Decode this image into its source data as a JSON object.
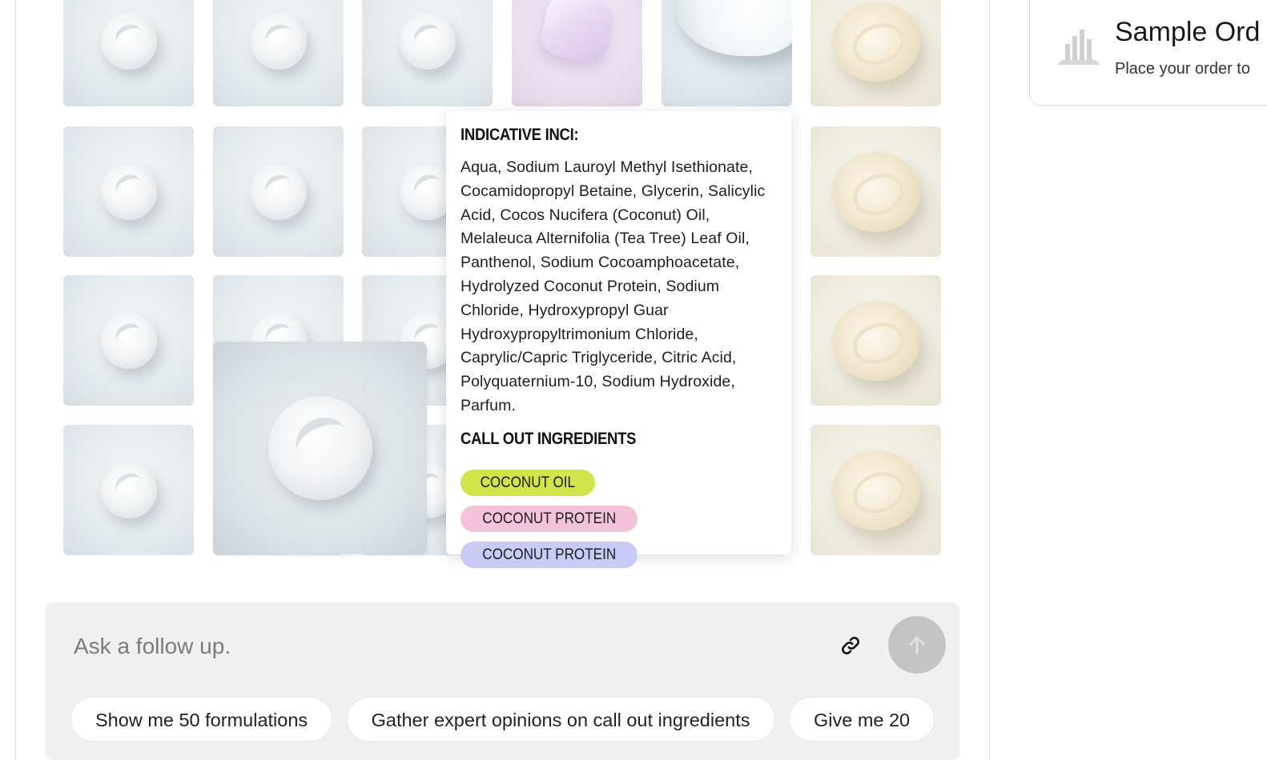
{
  "popover": {
    "inci_heading": "INDICATIVE INCI:",
    "inci_text": "Aqua, Sodium Lauroyl Methyl Isethionate, Cocamidopropyl Betaine, Glycerin, Salicylic Acid, Cocos Nucifera (Coconut) Oil, Melaleuca Alternifolia (Tea Tree) Leaf Oil, Panthenol, Sodium Cocoamphoacetate, Hydrolyzed Coconut Protein, Sodium Chloride, Hydroxypropyl Guar Hydroxypropyltrimonium Chloride, Caprylic/Capric Triglyceride, Citric Acid, Polyquaternium-10, Sodium Hydroxide, Parfum.",
    "callout_heading": "CALL OUT INGREDIENTS",
    "chips": [
      {
        "label": "COCONUT OIL",
        "color": "#cfe54a"
      },
      {
        "label": "COCONUT PROTEIN",
        "color": "#f3c3d9"
      },
      {
        "label": "COCONUT PROTEIN",
        "color": "#c9cbf6"
      }
    ]
  },
  "composer": {
    "placeholder": "Ask a follow up.",
    "link_icon": "link-icon",
    "send_icon": "arrow-up-icon"
  },
  "suggestions": [
    "Show me 50 formulations",
    "Gather expert opinions on call out ingredients",
    "Give me 20"
  ],
  "sample_card": {
    "title": "Sample Ord",
    "subtitle": "Place your order to",
    "icon": "bar-chart-icon"
  },
  "colors": {
    "accent_send_disabled": "#c4c4c4",
    "composer_bg": "#f0f0f0"
  }
}
